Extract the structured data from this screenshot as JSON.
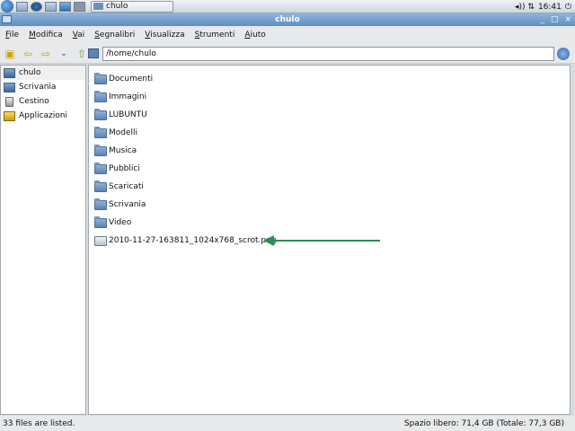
{
  "panel": {
    "task_label": "chulo",
    "clock": "16:41",
    "tray_symbols": "◂)) ⇅",
    "power_symbol": "⏻"
  },
  "window": {
    "title": "chulo",
    "controls": {
      "minimize": "_",
      "maximize": "□",
      "close": "×"
    }
  },
  "menu": {
    "items": [
      "File",
      "Modifica",
      "Vai",
      "Segnalibri",
      "Visualizza",
      "Strumenti",
      "Aiuto"
    ]
  },
  "toolbar": {
    "path": "/home/chulo"
  },
  "sidebar": {
    "items": [
      {
        "label": "chulo",
        "icon": "home-folder-icon"
      },
      {
        "label": "Scrivania",
        "icon": "desktop-icon"
      },
      {
        "label": "Cestino",
        "icon": "trash-icon"
      },
      {
        "label": "Applicazioni",
        "icon": "applications-icon"
      }
    ]
  },
  "files": [
    {
      "name": "Documenti",
      "icon": "folder-icon"
    },
    {
      "name": "Immagini",
      "icon": "folder-icon"
    },
    {
      "name": "LUBUNTU",
      "icon": "folder-icon"
    },
    {
      "name": "Modelli",
      "icon": "folder-icon"
    },
    {
      "name": "Musica",
      "icon": "folder-icon"
    },
    {
      "name": "Pubblici",
      "icon": "folder-icon"
    },
    {
      "name": "Scaricati",
      "icon": "folder-icon"
    },
    {
      "name": "Scrivania",
      "icon": "folder-icon"
    },
    {
      "name": "Video",
      "icon": "folder-icon"
    },
    {
      "name": "2010-11-27-163811_1024x768_scrot.png",
      "icon": "image-file-icon"
    }
  ],
  "status": {
    "count": "33 files are listed.",
    "space": "Spazio libero: 71,4 GB (Totale: 77,3 GB)"
  },
  "colors": {
    "arrow": "#2e8b57",
    "titlebar": "#5d8ec2"
  }
}
